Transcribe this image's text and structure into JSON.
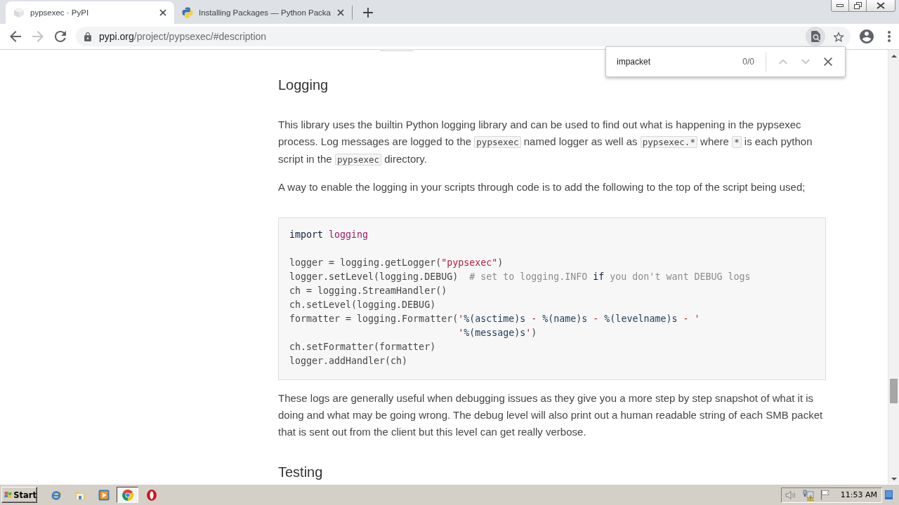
{
  "browser": {
    "tabs": [
      {
        "title": "pypsexec · PyPI",
        "kind": "cube",
        "selected": true
      },
      {
        "title": "Installing Packages — Python Packa",
        "kind": "snakes",
        "selected": false
      }
    ],
    "nav_buttons": [
      {
        "kind": "back",
        "disabled": false
      },
      {
        "kind": "forward",
        "disabled": true
      },
      {
        "kind": "reload",
        "disabled": false
      }
    ],
    "address_bar": {
      "host": "pypi.org",
      "path": "/project/pypsexec/#description"
    },
    "page_actions": [
      {
        "kind": "find",
        "active": true
      },
      {
        "kind": "bookmark",
        "active": false
      }
    ],
    "find_bar": {
      "value": "impacket",
      "count": "0/0",
      "buttons": [
        {
          "kind": "previous",
          "disabled": true
        },
        {
          "kind": "next",
          "disabled": true
        },
        {
          "kind": "close",
          "disabled": false
        }
      ]
    }
  },
  "article": {
    "blocks": [
      {
        "kind": "heading",
        "text": "Logging"
      },
      {
        "kind": "paragraph",
        "segments": [
          {
            "kind": "text",
            "text": "This library uses the builtin Python logging library and can be used to find out what is happening in the pypsexec process. Log messages are logged to the "
          },
          {
            "kind": "code",
            "text": "pypsexec"
          },
          {
            "kind": "text",
            "text": " named logger as well as "
          },
          {
            "kind": "code",
            "text": "pypsexec.*"
          },
          {
            "kind": "text",
            "text": " where "
          },
          {
            "kind": "code",
            "text": "*"
          },
          {
            "kind": "text",
            "text": " is each python script in the "
          },
          {
            "kind": "code",
            "text": "pypsexec"
          },
          {
            "kind": "text",
            "text": " directory."
          }
        ]
      },
      {
        "kind": "paragraph",
        "segments": [
          {
            "kind": "text",
            "text": "A way to enable the logging in your scripts through code is to add the following to the top of the script being used;"
          }
        ]
      },
      {
        "kind": "code",
        "groups": [
          {
            "lines": [
              {
                "tokens": [
                  {
                    "kind": "keyword",
                    "text": "import"
                  },
                  {
                    "kind": "namespace",
                    "text": " logging"
                  }
                ]
              }
            ]
          },
          {
            "lines": [
              {
                "tokens": [
                  {
                    "kind": "plain",
                    "text": "logger = logging.getLogger("
                  },
                  {
                    "kind": "string",
                    "text": "\"pypsexec\""
                  },
                  {
                    "kind": "plain",
                    "text": ")"
                  }
                ]
              },
              {
                "tokens": [
                  {
                    "kind": "plain",
                    "text": "logger.setLevel(logging.DEBUG)"
                  },
                  {
                    "kind": "comment",
                    "text": "  # set to logging.INFO "
                  },
                  {
                    "kind": "keyword",
                    "text": "if"
                  },
                  {
                    "kind": "comment",
                    "text": " you don't want DEBUG logs"
                  }
                ]
              },
              {
                "tokens": [
                  {
                    "kind": "plain",
                    "text": "ch = logging.StreamHandler()"
                  }
                ]
              },
              {
                "tokens": [
                  {
                    "kind": "plain",
                    "text": "ch.setLevel(logging.DEBUG)"
                  }
                ]
              },
              {
                "tokens": [
                  {
                    "kind": "plain",
                    "text": "formatter = logging.Formatter("
                  },
                  {
                    "kind": "string",
                    "text": "'"
                  },
                  {
                    "kind": "interp",
                    "text": "%(asctime)s"
                  },
                  {
                    "kind": "string",
                    "text": " - "
                  },
                  {
                    "kind": "interp",
                    "text": "%(name)s"
                  },
                  {
                    "kind": "string",
                    "text": " - "
                  },
                  {
                    "kind": "interp",
                    "text": "%(levelname)s"
                  },
                  {
                    "kind": "string",
                    "text": " - '"
                  }
                ]
              },
              {
                "tokens": [
                  {
                    "kind": "string",
                    "text": "                              '"
                  },
                  {
                    "kind": "interp",
                    "text": "%(message)s"
                  },
                  {
                    "kind": "string",
                    "text": "'"
                  },
                  {
                    "kind": "plain",
                    "text": ")"
                  }
                ]
              },
              {
                "tokens": [
                  {
                    "kind": "plain",
                    "text": "ch.setFormatter(formatter)"
                  }
                ]
              },
              {
                "tokens": [
                  {
                    "kind": "plain",
                    "text": "logger.addHandler(ch)"
                  }
                ]
              }
            ]
          }
        ]
      },
      {
        "kind": "paragraph",
        "segments": [
          {
            "kind": "text",
            "text": "These logs are generally useful when debugging issues as they give you a more step by step snapshot of what it is doing and what may be going wrong. The debug level will also print out a human readable string of each SMB packet that is sent out from the client but this level can get really verbose."
          }
        ]
      },
      {
        "kind": "heading",
        "text": "Testing"
      }
    ]
  },
  "taskbar": {
    "start_label": "Start",
    "apps": [
      {
        "kind": "globe",
        "selected": false
      },
      {
        "kind": "folder",
        "selected": false
      },
      {
        "kind": "play",
        "selected": false
      },
      {
        "kind": "wheel",
        "selected": true
      },
      {
        "kind": "ring",
        "selected": false
      }
    ],
    "clock": "11:53 AM"
  }
}
